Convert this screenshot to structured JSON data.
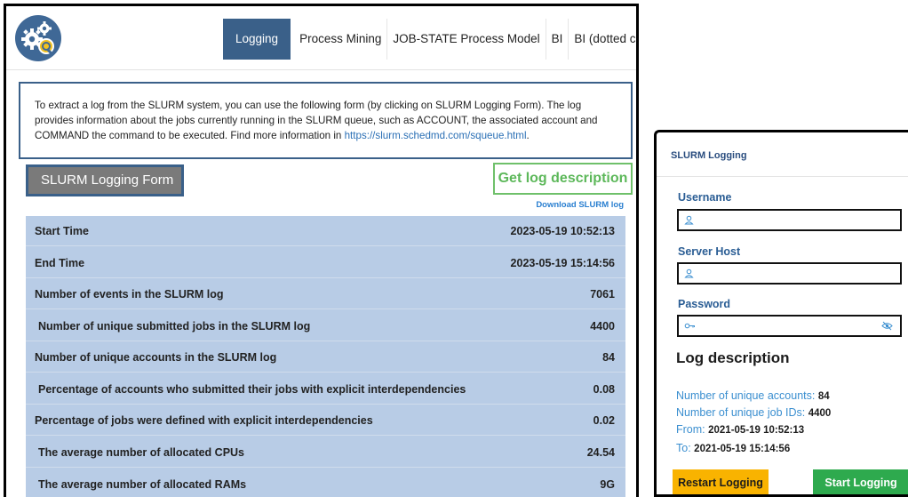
{
  "nav": {
    "logo_icon": "gears-search-icon",
    "tabs": [
      {
        "label": "Logging",
        "active": true
      },
      {
        "label": "Process Mining"
      },
      {
        "label": "JOB-STATE Process Model"
      },
      {
        "label": "BI"
      },
      {
        "label": "BI (dotted charts)"
      }
    ]
  },
  "info": {
    "text_before": "To extract a log from the SLURM system, you can use the following form (by clicking on SLURM Logging Form). The log provides information about the jobs currently running in the SLURM queue, such as ACCOUNT, the associated account and COMMAND the command to be executed. Find more information in ",
    "link": "https://slurm.schedmd.com/squeue.html",
    "text_after": "."
  },
  "actions": {
    "form_button": "SLURM Logging Form",
    "desc_button": "Get log description",
    "download_link": "Download SLURM log"
  },
  "stats": [
    {
      "label": "Start Time",
      "value": "2023-05-19  10:52:13"
    },
    {
      "label": "End Time",
      "value": "2023-05-19  15:14:56"
    },
    {
      "label": "Number of events in the SLURM log",
      "value": "7061"
    },
    {
      "label": "Number of unique submitted jobs in the SLURM log",
      "value": "4400"
    },
    {
      "label": "Number of unique accounts in the SLURM log",
      "value": "84"
    },
    {
      "label": "Percentage of accounts who submitted their jobs with explicit interdependencies",
      "value": "0.08"
    },
    {
      "label": "Percentage of jobs were defined with explicit interdependencies",
      "value": "0.02"
    },
    {
      "label": "The average number of allocated CPUs",
      "value": "24.54"
    },
    {
      "label": "The average number of allocated RAMs",
      "value": "9G"
    }
  ],
  "panel": {
    "title": "SLURM Logging",
    "username_label": "Username",
    "username_value": "",
    "server_label": "Server Host",
    "server_value": "",
    "password_label": "Password",
    "password_value": "",
    "log_desc_title": "Log description",
    "accounts_label": "Number of unique accounts:",
    "accounts_value": "84",
    "jobs_label": "Number of unique job IDs:",
    "jobs_value": "4400",
    "from_label": "From:",
    "from_value": "2021-05-19  10:52:13",
    "to_label": "To:",
    "to_value": "2021-05-19  15:14:56",
    "restart_button": "Restart Logging",
    "start_button": "Start Logging"
  },
  "colors": {
    "nav_active": "#3a6089",
    "stats_bg": "#b8cce6",
    "desc_green": "#5db85a",
    "restart_yellow": "#f9b300",
    "start_green": "#2eaa4e"
  }
}
